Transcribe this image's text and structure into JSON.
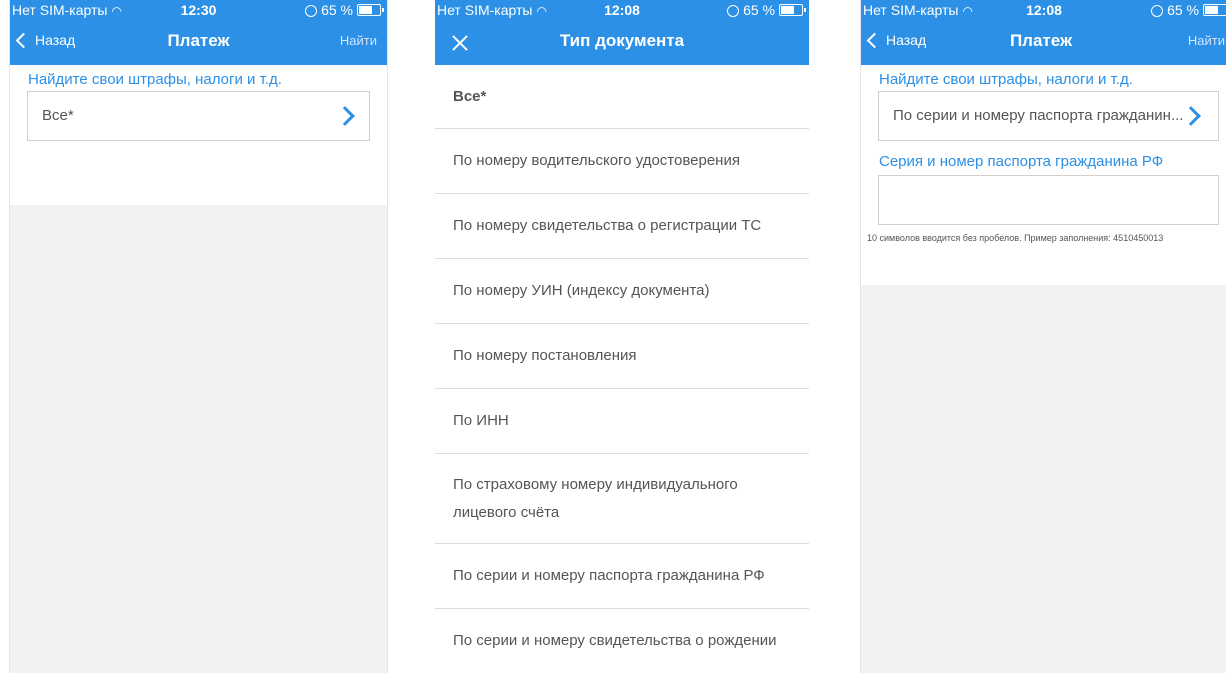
{
  "screens": [
    {
      "status": {
        "carrier": "Нет SIM-карты",
        "time": "12:30",
        "battery": "65 %"
      },
      "nav": {
        "back": "Назад",
        "title": "Платеж",
        "action": "Найти"
      },
      "section_label": "Найдите свои штрафы, налоги и т.д.",
      "select_value": "Все*"
    },
    {
      "status": {
        "carrier": "Нет SIM-карты",
        "time": "12:08",
        "battery": "65 %"
      },
      "nav": {
        "title": "Тип документа"
      },
      "items": [
        "Все*",
        "По номеру водительского удостоверения",
        "По номеру свидетельства о регистрации ТС",
        "По номеру УИН (индексу документа)",
        "По номеру постановления",
        "По ИНН",
        "По страховому номеру индивидуального лицевого счёта",
        "По серии и номеру паспорта гражданина РФ",
        "По серии и номеру свидетельства о рождении"
      ]
    },
    {
      "status": {
        "carrier": "Нет SIM-карты",
        "time": "12:08",
        "battery": "65 %"
      },
      "nav": {
        "back": "Назад",
        "title": "Платеж",
        "action": "Найти"
      },
      "section_label": "Найдите свои штрафы, налоги и т.д.",
      "select_value": "По серии и номеру паспорта гражданин...",
      "field_label": "Серия и номер паспорта гражданина РФ",
      "field_value": "",
      "hint": "10 символов вводится без пробелов. Пример заполнения: 4510450013"
    }
  ],
  "colors": {
    "accent": "#2b90e6",
    "background_gray": "#f2f2f2"
  }
}
